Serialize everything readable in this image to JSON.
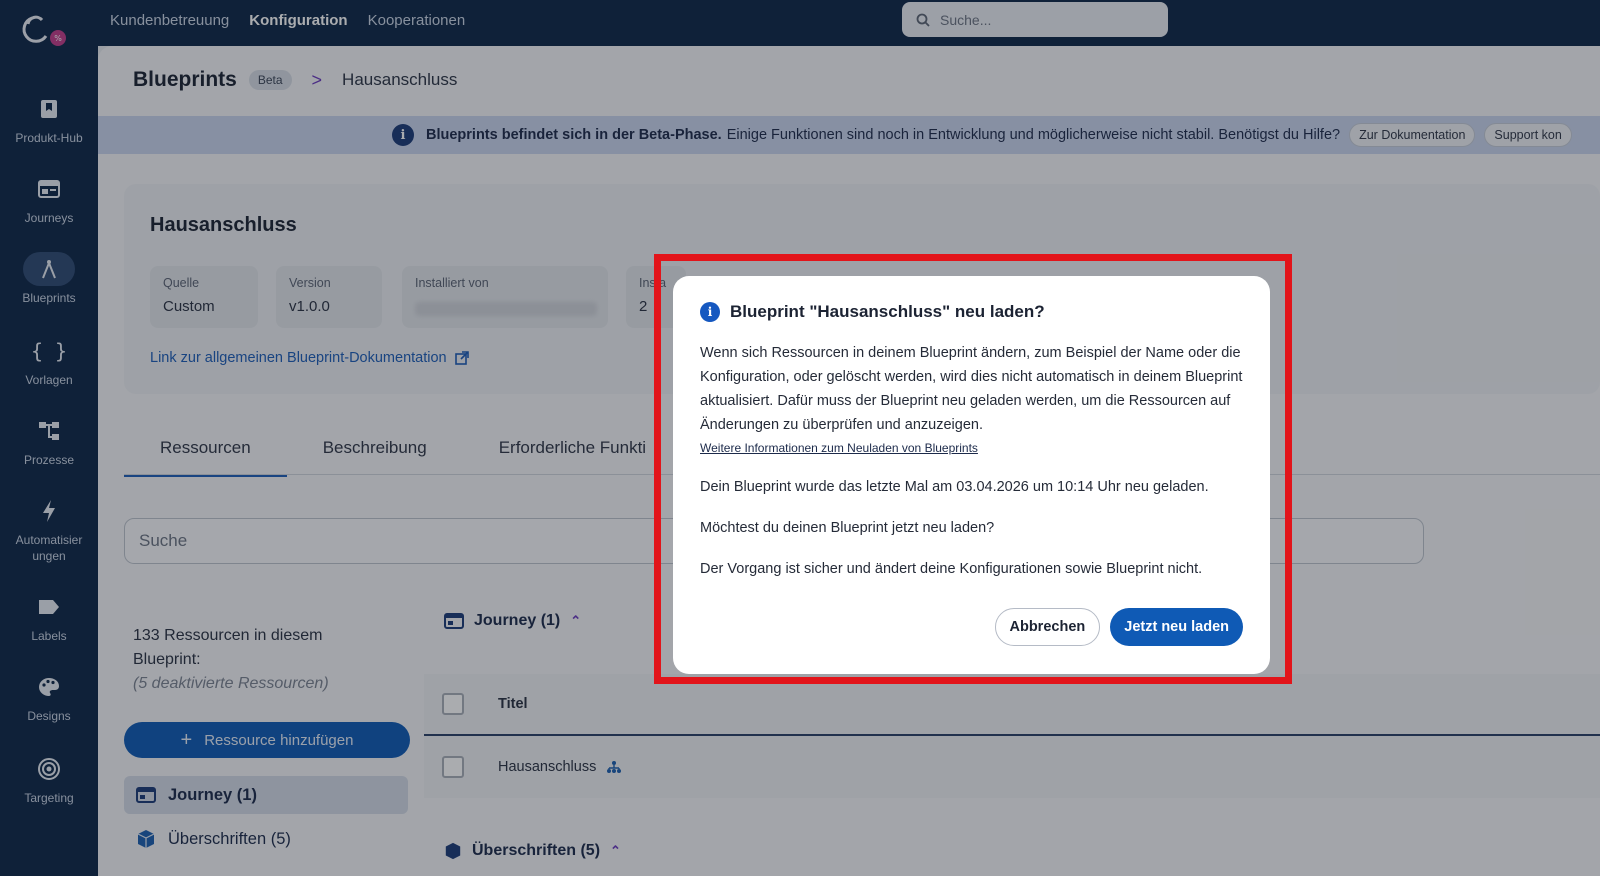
{
  "topnav": {
    "items": [
      "Kundenbetreuung",
      "Konfiguration",
      "Kooperationen"
    ],
    "search_placeholder": "Suche..."
  },
  "sidebar": {
    "items": [
      {
        "label": "Produkt-Hub",
        "icon": "bookmark-icon"
      },
      {
        "label": "Journeys",
        "icon": "journey-icon"
      },
      {
        "label": "Blueprints",
        "icon": "compass-icon"
      },
      {
        "label": "Vorlagen",
        "icon": "braces-icon"
      },
      {
        "label": "Prozesse",
        "icon": "process-icon"
      },
      {
        "label": "Automatisierungen",
        "icon": "bolt-icon"
      },
      {
        "label": "Labels",
        "icon": "label-icon"
      },
      {
        "label": "Designs",
        "icon": "palette-icon"
      },
      {
        "label": "Targeting",
        "icon": "target-icon"
      }
    ]
  },
  "breadcrumb": {
    "root": "Blueprints",
    "badge": "Beta",
    "separator": ">",
    "current": "Hausanschluss"
  },
  "banner": {
    "bold": "Blueprints befindet sich in der Beta-Phase.",
    "text": "Einige Funktionen sind noch in Entwicklung und möglicherweise nicht stabil. Benötigst du Hilfe?",
    "btn_docs": "Zur Dokumentation",
    "btn_support": "Support kon"
  },
  "detail": {
    "title": "Hausanschluss",
    "source_label": "Quelle",
    "source_value": "Custom",
    "version_label": "Version",
    "version_value": "v1.0.0",
    "installed_label": "Installiert von",
    "installed_at_label": "Insta",
    "installed_at_value": "2",
    "doc_link": "Link zur allgemeinen Blueprint-Dokumentation"
  },
  "tabs": [
    "Ressourcen",
    "Beschreibung",
    "Erforderliche Funkti"
  ],
  "resource_search": {
    "placeholder": "Suche"
  },
  "resources": {
    "count_text": "133 Ressourcen in diesem Blueprint:",
    "deactivated": "(5 deaktivierte Ressourcen)",
    "add_button": "Ressource hinzufügen",
    "list": [
      "Journey (1)",
      "Überschriften (5)"
    ]
  },
  "table": {
    "section": "Journey (1)",
    "section2": "Überschriften (5)",
    "header_title": "Titel",
    "rows": [
      "Hausanschluss"
    ]
  },
  "modal": {
    "title": "Blueprint \"Hausanschluss\" neu laden?",
    "paragraph1": "Wenn sich Ressourcen in deinem Blueprint ändern, zum Beispiel der Name oder die Konfiguration, oder gelöscht werden, wird dies nicht automatisch in deinem Blueprint aktualisiert. Dafür muss der Blueprint neu geladen werden, um die Ressourcen auf Änderungen zu überprüfen und anzuzeigen.",
    "link": "Weitere Informationen zum Neuladen von Blueprints",
    "paragraph2": "Dein Blueprint wurde das letzte Mal am 03.04.2026 um 10:14 Uhr neu geladen.",
    "paragraph3": "Möchtest du deinen Blueprint jetzt neu laden?",
    "paragraph4": "Der Vorgang ist sicher und ändert deine Konfigurationen sowie Blueprint nicht.",
    "cancel": "Abbrechen",
    "confirm": "Jetzt neu laden"
  },
  "colors": {
    "nav": "#0e2647",
    "primary": "#0f5ab5",
    "highlight": "#e2141a"
  }
}
